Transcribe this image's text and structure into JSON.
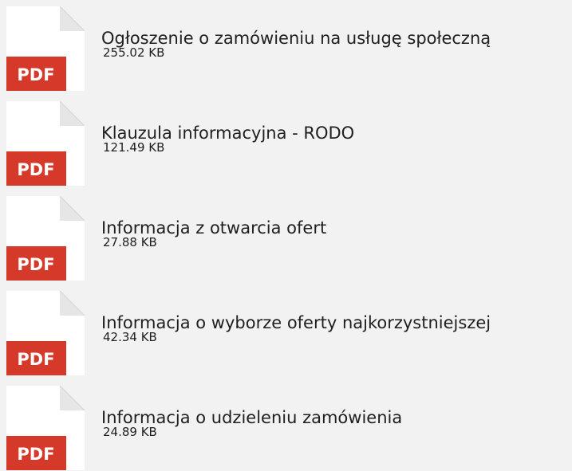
{
  "attachments": {
    "icon_name": "pdf-file-icon",
    "icon_badge_text": "PDF",
    "colors": {
      "background": "#f2f2f2",
      "page": "#ffffff",
      "badge": "#d5392a",
      "text": "#1f1f1f"
    },
    "items": [
      {
        "name": "Ogłoszenie o zamówieniu na usługę społeczną",
        "size": "255.02 KB"
      },
      {
        "name": "Klauzula informacyjna - RODO",
        "size": "121.49 KB"
      },
      {
        "name": "Informacja z otwarcia ofert",
        "size": "27.88 KB"
      },
      {
        "name": "Informacja o wyborze oferty najkorzystniejszej",
        "size": "42.34 KB"
      },
      {
        "name": "Informacja o udzieleniu zamówienia",
        "size": "24.89 KB"
      }
    ]
  }
}
